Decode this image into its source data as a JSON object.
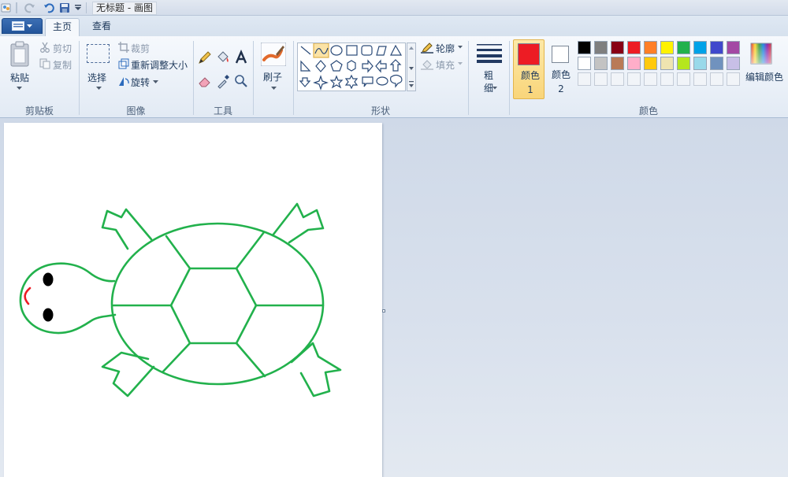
{
  "window": {
    "title": "无标题 - 画图"
  },
  "tabs": [
    {
      "label": "主页",
      "active": true
    },
    {
      "label": "查看",
      "active": false
    }
  ],
  "clipboard": {
    "paste": "粘贴",
    "cut": "剪切",
    "copy": "复制",
    "group": "剪贴板"
  },
  "image": {
    "select": "选择",
    "crop": "裁剪",
    "resize": "重新调整大小",
    "rotate": "旋转",
    "group": "图像"
  },
  "tools": {
    "group": "工具"
  },
  "brushes": {
    "label": "刷子"
  },
  "shapes": {
    "outline": "轮廓",
    "fill": "填充",
    "group": "形状"
  },
  "size": {
    "label": "粗细"
  },
  "colors": {
    "color1": "颜色 1",
    "color2": "颜色 2",
    "edit": "编辑颜色",
    "group": "颜色",
    "color1_value": "#ed1c24",
    "color2_value": "#ffffff",
    "palette_row1": [
      "#000000",
      "#7f7f7f",
      "#880015",
      "#ed1c24",
      "#ff7f27",
      "#fff200",
      "#22b14c",
      "#00a2e8",
      "#3f48cc",
      "#a349a4"
    ],
    "palette_row2": [
      "#ffffff",
      "#c3c3c3",
      "#b97a57",
      "#ffaec9",
      "#ffc90e",
      "#efe4b0",
      "#b5e61d",
      "#99d9ea",
      "#7092be",
      "#c8bfe7"
    ]
  },
  "drawing": {
    "stroke_color": "#22b14c",
    "eye_color": "#000000",
    "mouth_color": "#ed1c24"
  }
}
